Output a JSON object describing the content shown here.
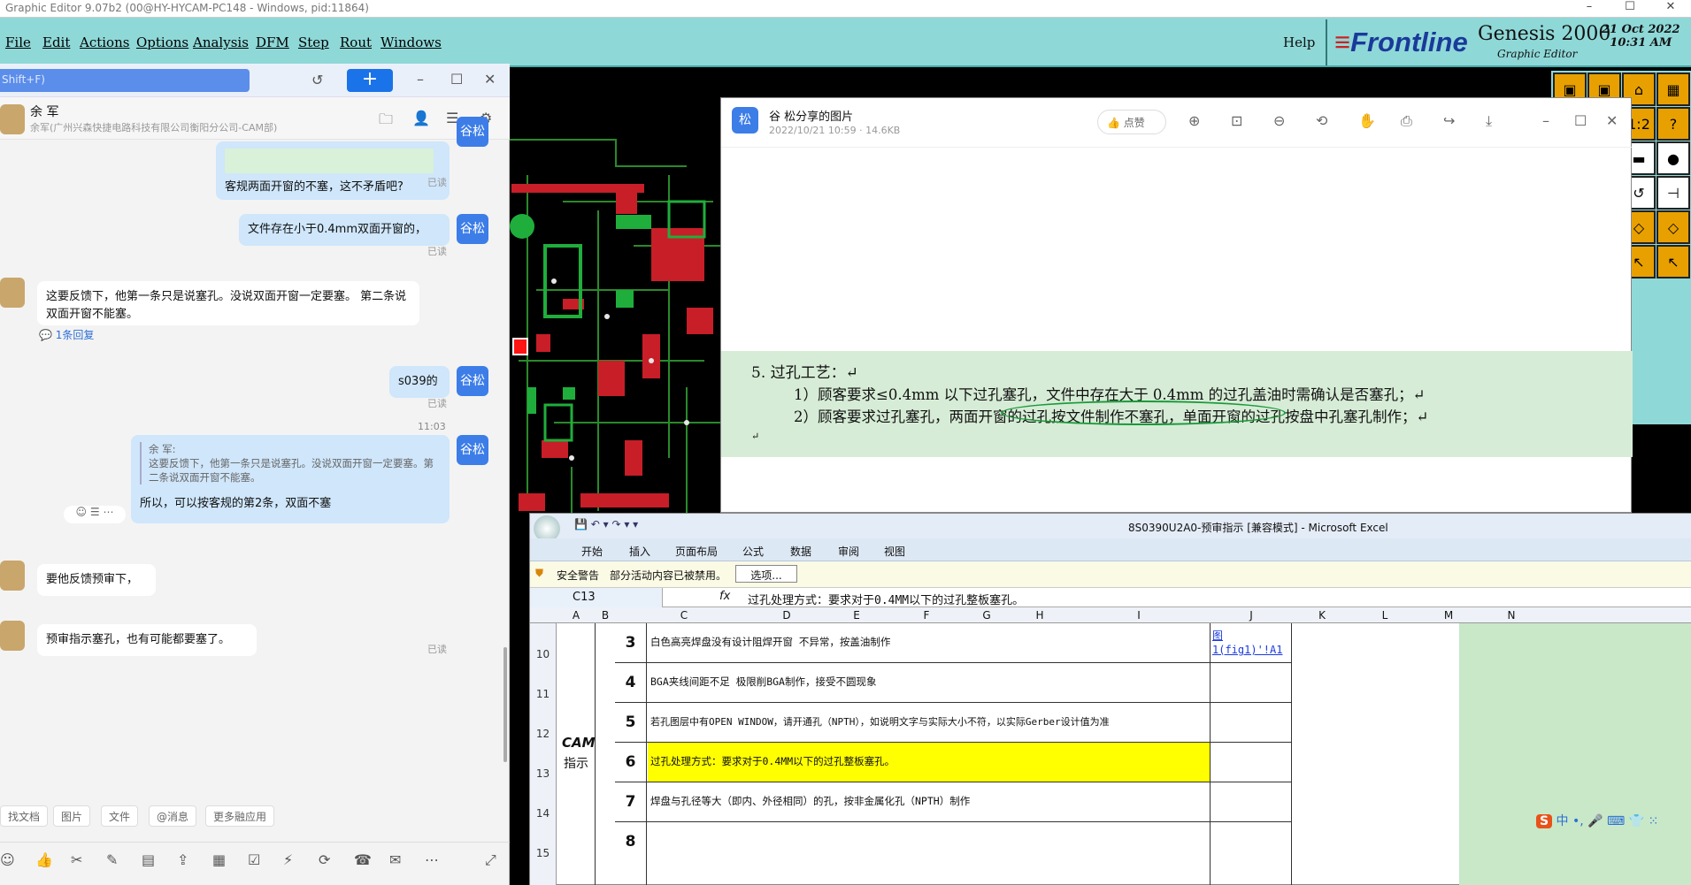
{
  "genesis": {
    "titlebar": "Graphic Editor 9.07b2 (00@HY-HYCAM-PC148 - Windows, pid:11864)",
    "menu": [
      "File",
      "Edit",
      "Actions",
      "Options",
      "Analysis",
      "DFM",
      "Step",
      "Rout",
      "Windows"
    ],
    "help": "Help",
    "brand": {
      "logo_f": "F",
      "logo_rest": "rontline",
      "product": "Genesis 2000",
      "subtitle": "Graphic Editor",
      "date": "21 Oct 2022",
      "time": "10:31 AM"
    },
    "tools": [
      "▣",
      "▣",
      "⌂",
      "▦",
      "□",
      "▭",
      "1:2",
      "?",
      "⁝",
      "⁞",
      "▬",
      "●",
      "↗",
      "↗",
      "↺",
      "⊣",
      "≡",
      "⊞",
      "◇",
      "◇",
      "⊼",
      "⊼",
      "↖",
      "↖"
    ]
  },
  "chat": {
    "search_placeholder": "Shift+F)",
    "contact_name": "余 军",
    "contact_company": "余军(广州兴森快捷电路科技有限公司衡阳分公司-CAM部)",
    "messages": [
      {
        "side": "right",
        "text": "客规两面开窗的不塞，这不矛盾吧?",
        "read": "已读",
        "avatar": "谷松"
      },
      {
        "side": "right",
        "text": "文件存在小于0.4mm双面开窗的，",
        "read": "已读",
        "avatar": "谷松"
      },
      {
        "side": "left",
        "text": "这要反馈下，他第一条只是说塞孔。没说双面开窗一定要塞。 第二条说双面开窗不能塞。",
        "reply": "1条回复"
      },
      {
        "side": "right",
        "text": "s039的",
        "read": "已读",
        "avatar": "谷松"
      },
      {
        "side": "right",
        "time": "11:03",
        "quote_author": "余 军:",
        "quote": "这要反馈下，他第一条只是说塞孔。没说双面开窗一定要塞。第二条说双面开窗不能塞。",
        "text": "所以，可以按客规的第2条，双面不塞",
        "read": "已读",
        "avatar": "谷松"
      },
      {
        "side": "left",
        "text": "要他反馈预审下，"
      },
      {
        "side": "left",
        "text": "预审指示塞孔，也有可能都要塞了。"
      }
    ],
    "buttons": [
      "找文档",
      "图片",
      "文件",
      "@消息",
      "更多融应用"
    ]
  },
  "viewer": {
    "avatar": "松",
    "title": "谷 松分享的图片",
    "meta": "2022/10/21 10:59 · 14.6KB",
    "like": "点赞",
    "image_lines": [
      "5.    过孔工艺：↵",
      "1）顾客要求≤0.4mm 以下过孔塞孔，文件中存在大于 0.4mm 的过孔盖油时需确认是否塞孔；↵",
      "2）顾客要求过孔塞孔，两面开窗的过孔按文件制作不塞孔，单面开窗的过孔按盘中孔塞孔制作；↵",
      "↵"
    ]
  },
  "excel": {
    "title": "8S0390U2A0-预审指示  [兼容模式] - Microsoft Excel",
    "tabs": [
      "开始",
      "插入",
      "页面布局",
      "公式",
      "数据",
      "审阅",
      "视图"
    ],
    "warning": "安全警告",
    "warning_text": "部分活动内容已被禁用。",
    "options": "选项...",
    "namebox": "C13",
    "formula": "过孔处理方式：要求对于0.4MM以下的过孔整板塞孔。",
    "columns": [
      "A",
      "B",
      "C",
      "D",
      "E",
      "F",
      "G",
      "H",
      "I",
      "J",
      "K",
      "L",
      "M",
      "N"
    ],
    "group_label": "CAM",
    "group_label2": "指示",
    "link": "图1(fig1)'!A1",
    "rows": [
      {
        "row": "10",
        "num": "3",
        "text": "白色高亮焊盘没有设计阻焊开窗 不异常，按盖油制作"
      },
      {
        "row": "11",
        "num": "4",
        "text": "BGA夹线间距不足 极限削BGA制作，接受不圆现象"
      },
      {
        "row": "12",
        "num": "5",
        "text": "若孔图层中有OPEN WINDOW，请开通孔（NPTH），如说明文字与实际大小不符，以实际Gerber设计值为准"
      },
      {
        "row": "13",
        "num": "6",
        "text": "过孔处理方式：要求对于0.4MM以下的过孔整板塞孔。",
        "highlight": true
      },
      {
        "row": "14",
        "num": "7",
        "text": "焊盘与孔径等大（即内、外径相同）的孔，按非金属化孔（NPTH）制作"
      },
      {
        "row": "15",
        "num": "8",
        "text": ""
      }
    ]
  },
  "ime": "S 中 •, 🎤 ⌨ 👕 ⁙"
}
